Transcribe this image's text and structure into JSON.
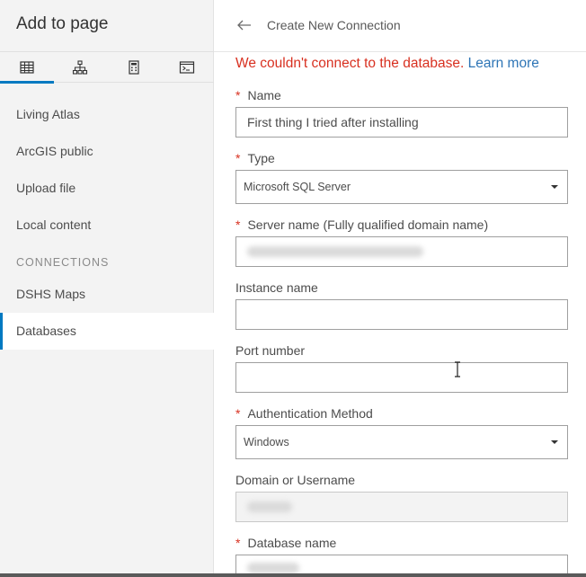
{
  "sidebar": {
    "title": "Add to page",
    "tabs": [
      {
        "icon": "table-grid-icon",
        "active": true
      },
      {
        "icon": "hierarchy-icon",
        "active": false
      },
      {
        "icon": "calculator-icon",
        "active": false
      },
      {
        "icon": "terminal-icon",
        "active": false
      }
    ],
    "items": [
      {
        "label": "Living Atlas"
      },
      {
        "label": "ArcGIS public"
      },
      {
        "label": "Upload file"
      },
      {
        "label": "Local content"
      }
    ],
    "connections_heading": "CONNECTIONS",
    "connections": [
      {
        "label": "DSHS Maps",
        "active": false
      },
      {
        "label": "Databases",
        "active": true
      }
    ]
  },
  "header": {
    "back_icon": "arrow-left-icon",
    "title": "Create New Connection"
  },
  "error": {
    "message": "We couldn't connect to the database.",
    "link": "Learn more",
    "color": "#d83020",
    "link_color": "#2e75b6"
  },
  "form": {
    "name": {
      "label": "Name",
      "required": true,
      "value": "First thing I tried after installing"
    },
    "type": {
      "label": "Type",
      "required": true,
      "value": "Microsoft SQL Server"
    },
    "server_name": {
      "label": "Server name  (Fully qualified domain name)",
      "required": true
    },
    "instance_name": {
      "label": "Instance name",
      "required": false,
      "value": ""
    },
    "port_number": {
      "label": "Port number",
      "required": false,
      "value": ""
    },
    "auth_method": {
      "label": "Authentication Method",
      "required": true,
      "value": "Windows"
    },
    "domain_username": {
      "label": "Domain or Username",
      "required": false
    },
    "database_name": {
      "label": "Database name",
      "required": true
    }
  },
  "required_marker": "*",
  "accent_color": "#0079c1"
}
